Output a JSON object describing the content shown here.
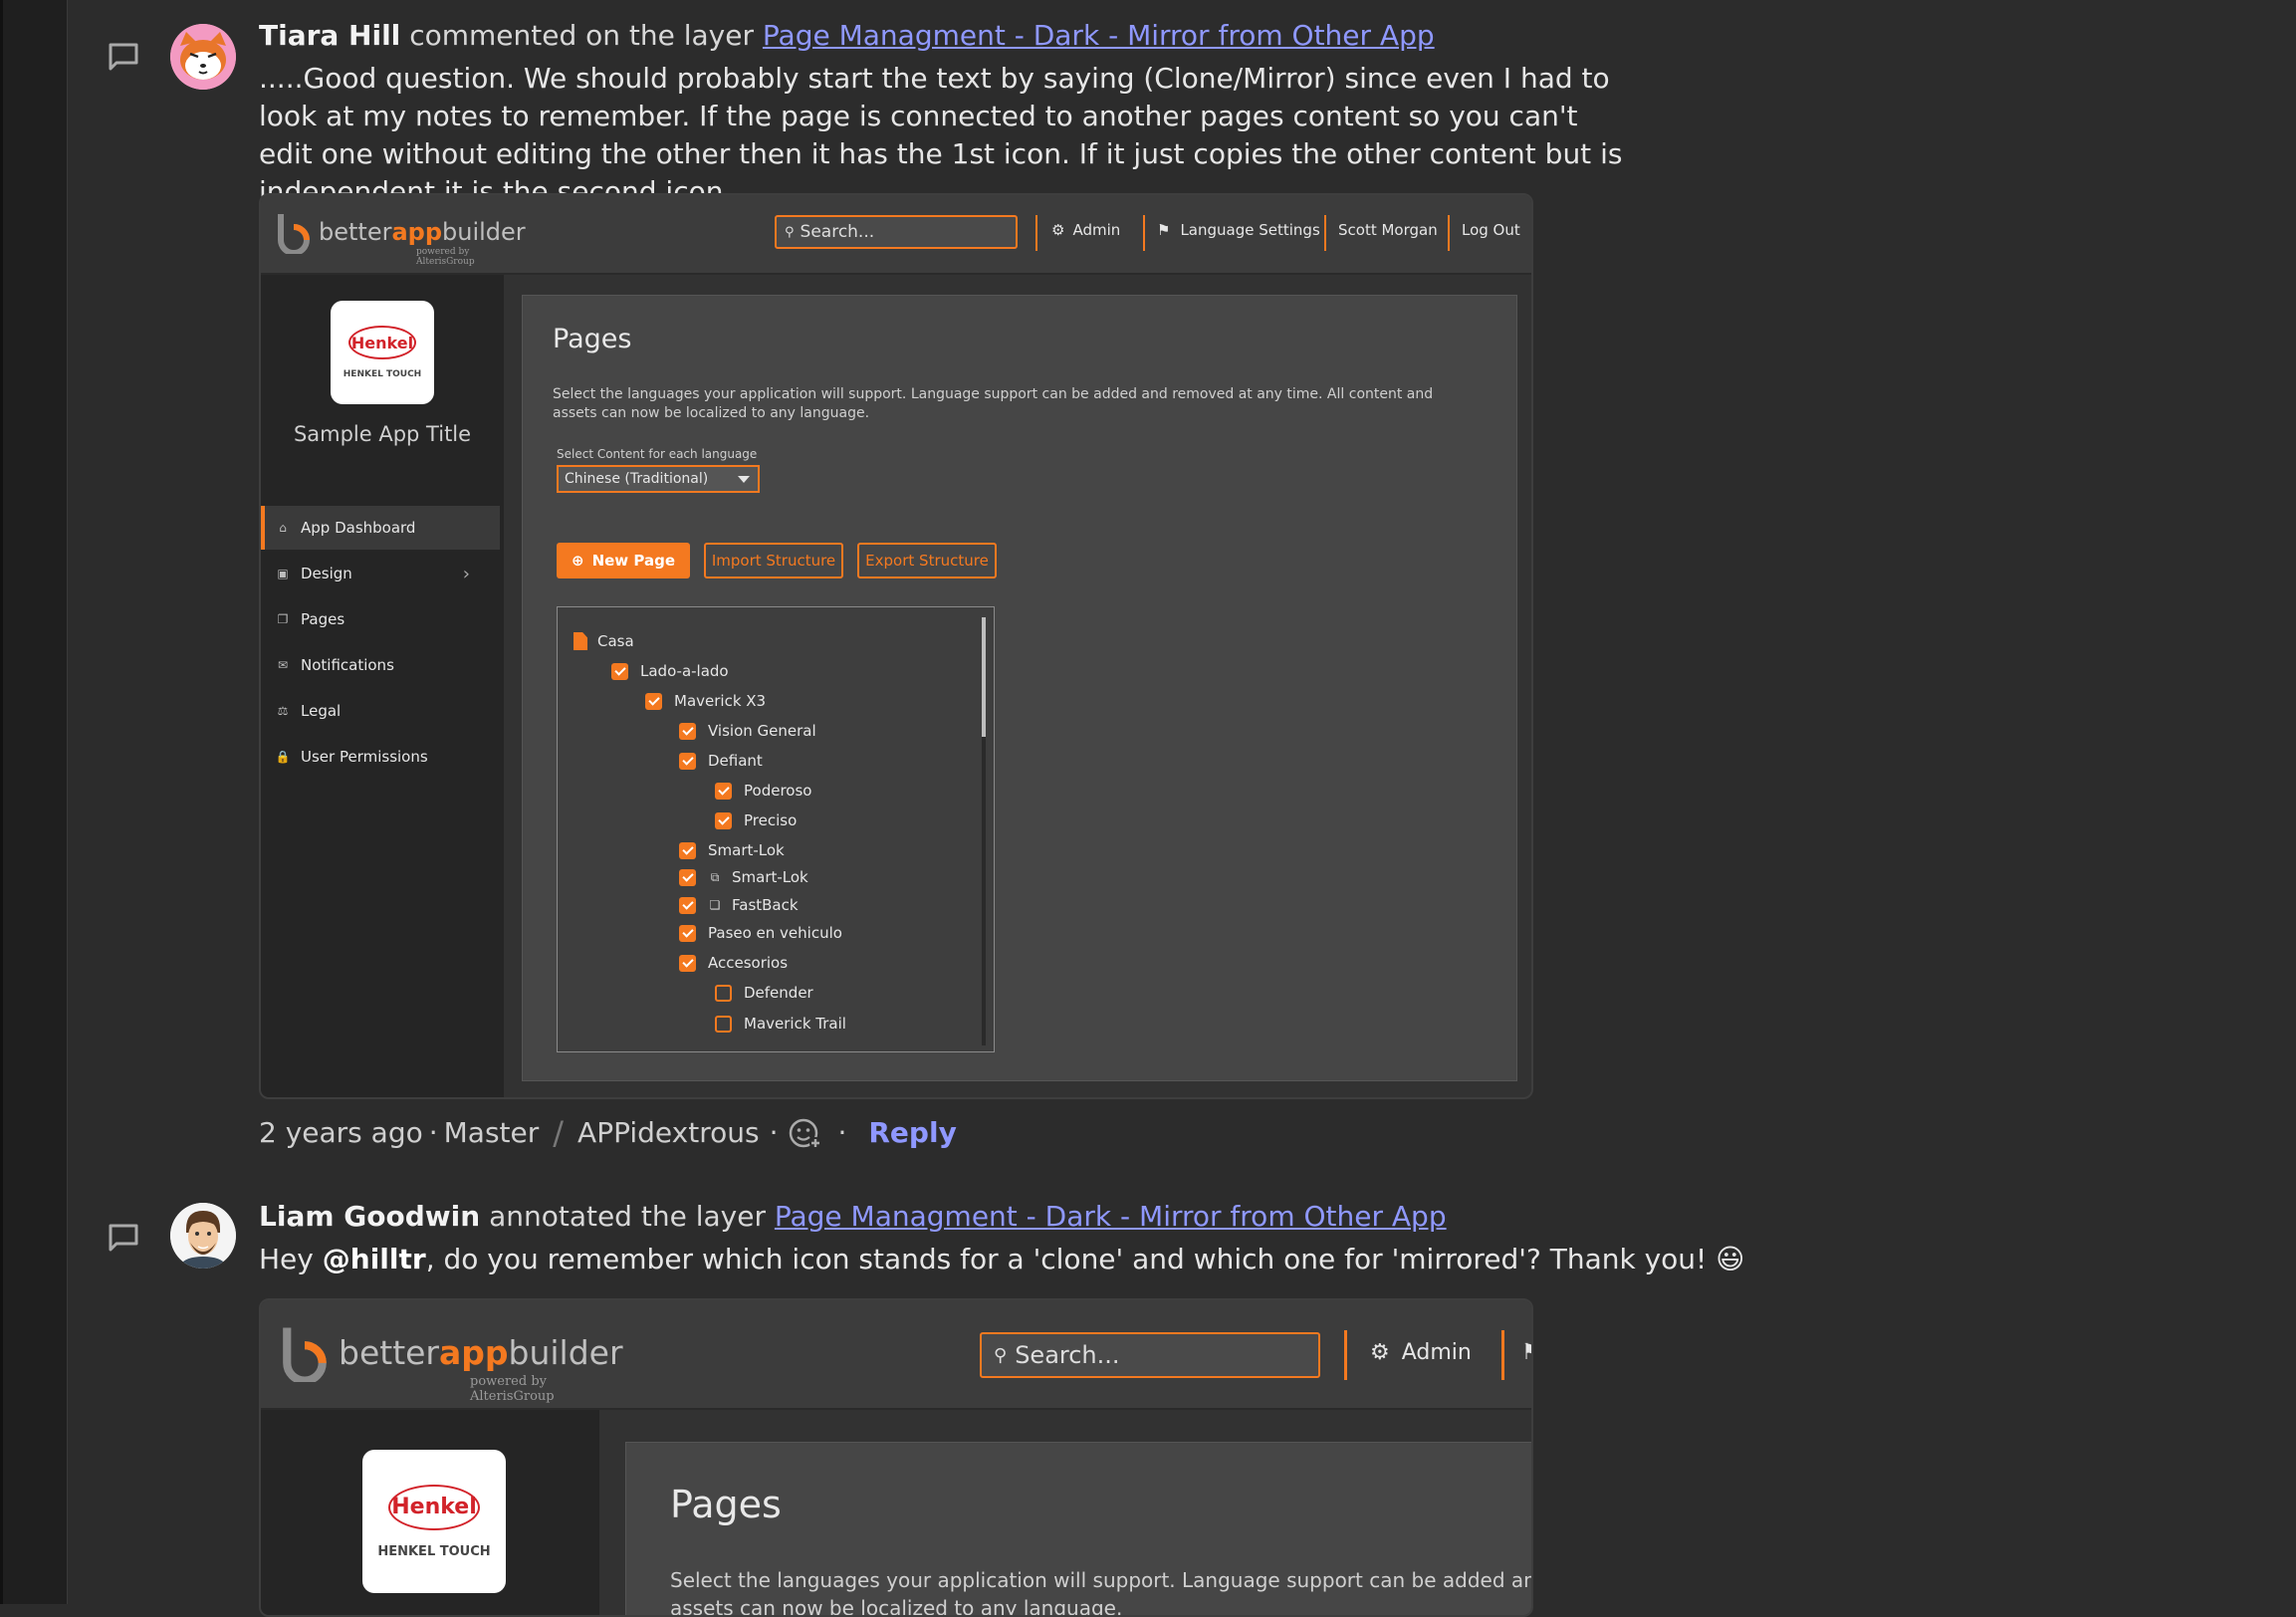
{
  "comments": [
    {
      "author": "Tiara Hill",
      "action": "commented on the layer",
      "layer_link": "Page Managment - Dark - Mirror from Other App",
      "body": ".....Good question. We should probably start the text by saying (Clone/Mirror) since even I had to look at my notes to remember. If the page is connected to another pages content so you can't edit one without editing the other then it has the 1st icon. If it just copies the other content but is independent it is the second icon.",
      "meta": {
        "time": "2 years ago",
        "branch": "Master",
        "project": "APPidextrous",
        "reply": "Reply"
      }
    },
    {
      "author": "Liam Goodwin",
      "action": "annotated the layer",
      "layer_link": "Page Managment - Dark - Mirror from Other App",
      "body_pre": "Hey ",
      "mention": "@hilltr",
      "body_post": ", do you remember which icon stands for a 'clone' and which one for 'mirrored'? Thank you! 😃"
    }
  ],
  "app": {
    "logo_word": "better",
    "logo_accent": "app",
    "logo_word2": "builder",
    "powered_by": "powered by AlterisGroup",
    "search_placeholder": "Search...",
    "nav": [
      "Admin",
      "Language Settings",
      "Scott Morgan",
      "Log Out"
    ],
    "brand_logo": "Henkel",
    "brand_caption": "HENKEL TOUCH",
    "app_title": "Sample App Title",
    "sidebar": [
      {
        "label": "App Dashboard",
        "icon": "home-icon"
      },
      {
        "label": "Design",
        "icon": "image-icon"
      },
      {
        "label": "Pages",
        "icon": "pages-icon"
      },
      {
        "label": "Notifications",
        "icon": "mail-icon"
      },
      {
        "label": "Legal",
        "icon": "scale-icon"
      },
      {
        "label": "User Permissions",
        "icon": "lock-icon"
      }
    ],
    "page_title": "Pages",
    "page_desc": "Select the languages your application will support. Language support can be added and removed at any time. All content and assets can now be localized to any language.",
    "select_label": "Select Content for each language",
    "select_value": "Chinese (Traditional)",
    "buttons": {
      "new_page": "New Page",
      "import": "Import Structure",
      "export": "Export Structure"
    },
    "tree": [
      {
        "label": "Casa",
        "level": 0,
        "type": "page"
      },
      {
        "label": "Lado-a-lado",
        "level": 1,
        "type": "checked"
      },
      {
        "label": "Maverick X3",
        "level": 2,
        "type": "checked"
      },
      {
        "label": "Vision General",
        "level": 3,
        "type": "checked"
      },
      {
        "label": "Defiant",
        "level": 3,
        "type": "checked"
      },
      {
        "label": "Poderoso",
        "level": 4,
        "type": "checked"
      },
      {
        "label": "Preciso",
        "level": 4,
        "type": "checked"
      },
      {
        "label": "Smart-Lok",
        "level": 3,
        "type": "checked"
      },
      {
        "label": "Smart-Lok",
        "level": 3,
        "type": "checked-mirror"
      },
      {
        "label": "FastBack",
        "level": 3,
        "type": "checked-clone"
      },
      {
        "label": "Paseo en vehiculo",
        "level": 3,
        "type": "checked"
      },
      {
        "label": "Accesorios",
        "level": 3,
        "type": "checked"
      },
      {
        "label": "Defender",
        "level": 4,
        "type": "unchecked"
      },
      {
        "label": "Maverick Trail",
        "level": 4,
        "type": "unchecked"
      }
    ]
  },
  "colors": {
    "accent": "#f47920",
    "link": "#8f98ff",
    "henkel_red": "#d2232a"
  }
}
